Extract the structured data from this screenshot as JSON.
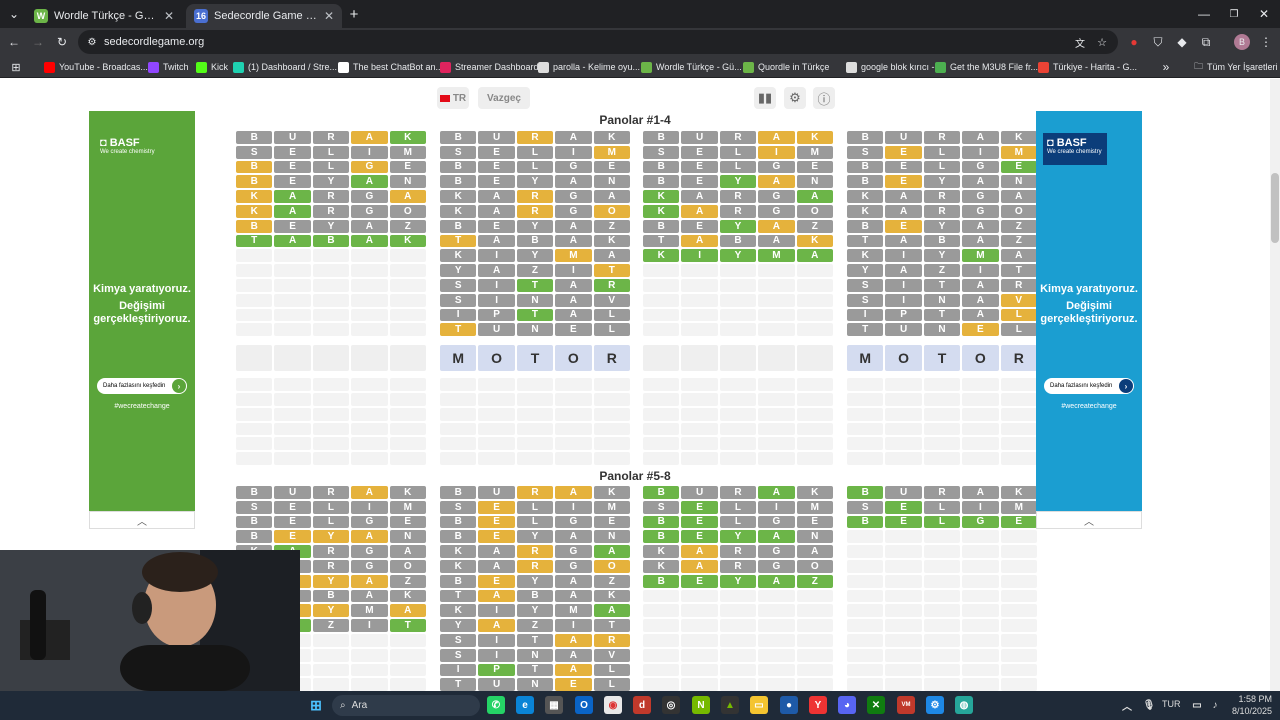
{
  "browser": {
    "tabs": [
      {
        "favicon": "W",
        "title": "Wordle Türkçe - Günlük Kelime",
        "active": false
      },
      {
        "favicon": "16",
        "title": "Sedecordle Game - 16 Words W",
        "active": true
      }
    ],
    "url": "sedecordlegame.org",
    "bookmarks": [
      {
        "label": "YouTube - Broadcas...",
        "icon_color": "#ff0000"
      },
      {
        "label": "Twitch",
        "icon_color": "#9146ff"
      },
      {
        "label": "Kick",
        "icon_color": "#53fc18"
      },
      {
        "label": "(1) Dashboard / Stre...",
        "icon_color": "#1fd1b1"
      },
      {
        "label": "The best ChatBot an...",
        "icon_color": "#ffffff"
      },
      {
        "label": "Streamer Dashboard",
        "icon_color": "#e0245e"
      },
      {
        "label": "parolla - Kelime oyu...",
        "icon_color": "#dddddd"
      },
      {
        "label": "Wordle Türkçe - Gü...",
        "icon_color": "#6cb548"
      },
      {
        "label": "Quordle in Türkçe",
        "icon_color": "#6cb548"
      },
      {
        "label": "google blok kırıcı -...",
        "icon_color": "#dddddd"
      },
      {
        "label": "Get the M3U8 File fr...",
        "icon_color": "#4caf50"
      },
      {
        "label": "Türkiye - Harita - G...",
        "icon_color": "#ea4335"
      }
    ],
    "all_bookmarks_label": "Tüm Yer İşaretleri",
    "profile_initial": "B"
  },
  "game": {
    "lang_label": "TR",
    "cancel_label": "Vazgeç",
    "section1_title": "Panolar #1-4",
    "section2_title": "Panolar #5-8",
    "current_input": [
      "M",
      "O",
      "T",
      "O",
      "R"
    ],
    "boards_top": [
      {
        "rows": [
          "B:x U:x R:x A:y K:g",
          "S:x E:x L:x I:x M:x",
          "B:y E:x L:x G:y E:x",
          "B:y E:x Y:x A:g N:x",
          "K:y A:g R:x G:x A:y",
          "K:y A:g R:x G:x O:x",
          "B:y E:x Y:x A:x Z:x",
          "T:g A:g B:g A:g K:g"
        ],
        "filled": 8,
        "solved": true
      },
      {
        "rows": [
          "B:x U:x R:y A:x K:x",
          "S:x E:x L:x I:x M:y",
          "B:x E:x L:x G:x E:x",
          "B:x E:x Y:x A:x N:x",
          "K:x A:x R:y G:x A:x",
          "K:x A:x R:y G:x O:y",
          "B:x E:x Y:x A:x Z:x",
          "T:y A:x B:x A:x K:x",
          "K:x I:x Y:x M:y A:x",
          "Y:x A:x Z:x I:x T:y",
          "S:x I:x T:g A:x R:g",
          "S:x I:x N:x A:x V:x",
          "I:x P:x T:g A:x L:x",
          "T:y U:x N:x E:x L:x"
        ],
        "filled": 14,
        "solved": false
      },
      {
        "rows": [
          "B:x U:x R:x A:y K:y",
          "S:x E:x L:x I:y M:x",
          "B:x E:x L:x G:x E:x",
          "B:x E:x Y:g A:y N:x",
          "K:g A:x R:x G:x A:g",
          "K:g A:y R:x G:x O:x",
          "B:x E:x Y:g A:y Z:x",
          "T:x A:y B:x A:x K:y",
          "K:g I:g Y:g M:g A:g"
        ],
        "filled": 9,
        "solved": true
      },
      {
        "rows": [
          "B:x U:x R:x A:x K:x",
          "S:x E:y L:x I:x M:y",
          "B:x E:x L:x G:x E:g",
          "B:x E:y Y:x A:x N:x",
          "K:x A:x R:x G:x A:x",
          "K:x A:x R:x G:x O:x",
          "B:x E:y Y:x A:x Z:x",
          "T:x A:x B:x A:x Z:x",
          "K:x I:x Y:x M:g A:x",
          "Y:x A:x Z:x I:x T:x",
          "S:x I:x T:x A:x R:x",
          "S:x I:x N:x A:x V:y",
          "I:x P:x T:x A:x L:y",
          "T:x U:x N:x E:y L:x"
        ],
        "filled": 14,
        "solved": false
      }
    ],
    "boards_bottom": [
      {
        "rows": [
          "B:x U:x R:x A:y K:x",
          "S:x E:x L:x I:x M:x",
          "B:x E:x L:x G:x E:x",
          "B:x E:y Y:y A:y N:x",
          "K:x A:g R:x G:x A:x",
          "K:x A:x R:x G:x O:x",
          "B:x E:y Y:y A:y Z:x",
          "T:x A:x B:x A:x K:x",
          "K:x I:y Y:y M:x A:y",
          "Y:x A:g Z:x I:x T:g"
        ],
        "filled": 10,
        "solved": false
      },
      {
        "rows": [
          "B:x U:x R:y A:y K:x",
          "S:x E:y L:x I:x M:x",
          "B:x E:y L:x G:x E:x",
          "B:x E:y Y:x A:x N:x",
          "K:x A:x R:y G:x A:g",
          "K:x A:x R:y G:x O:y",
          "B:x E:y Y:x A:x Z:x",
          "T:x A:y B:x A:x K:x",
          "K:x I:x Y:x M:x A:g",
          "Y:x A:y Z:x I:x T:x",
          "S:x I:x T:x A:y R:y",
          "S:x I:x N:x A:x V:x",
          "I:x P:g T:x A:y L:x",
          "T:x U:x N:x E:y L:x"
        ],
        "filled": 14,
        "solved": false
      },
      {
        "rows": [
          "B:g U:x R:x A:g K:x",
          "S:x E:g L:x I:x M:x",
          "B:g E:g L:x G:x E:x",
          "B:g E:g Y:g A:g N:x",
          "K:x A:y R:x G:x A:x",
          "K:x A:y R:x G:x O:x",
          "B:g E:g Y:g A:g Z:g"
        ],
        "filled": 7,
        "solved": true
      },
      {
        "rows": [
          "B:g U:x R:x A:x K:x",
          "S:x E:g L:x I:x M:x",
          "B:g E:g L:g G:g E:g"
        ],
        "filled": 3,
        "solved": true
      }
    ]
  },
  "ads": {
    "brand": "BASF",
    "brand_sub": "We create chemistry",
    "headline1": "Kimya yaratıyoruz.",
    "headline2": "Değişimi gerçekleştiriyoruz.",
    "cta": "Daha fazlasını keşfedin",
    "hashtag": "#wecreatechange",
    "left_bg": "#5ba53a",
    "right_bg": "#1b9ed1"
  },
  "taskbar": {
    "search_label": "Ara",
    "lang": "TUR",
    "time": "1:58 PM",
    "date": "8/10/2025"
  }
}
